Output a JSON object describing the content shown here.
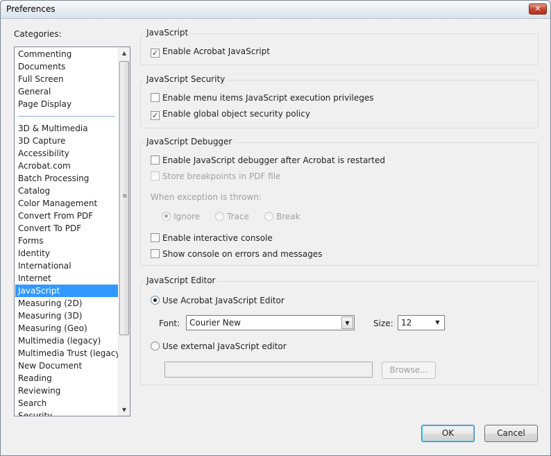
{
  "window": {
    "title": "Preferences",
    "close_glyph": "✕"
  },
  "categories": {
    "label": "Categories:",
    "top_items": [
      "Commenting",
      "Documents",
      "Full Screen",
      "General",
      "Page Display"
    ],
    "items": [
      "3D & Multimedia",
      "3D Capture",
      "Accessibility",
      "Acrobat.com",
      "Batch Processing",
      "Catalog",
      "Color Management",
      "Convert From PDF",
      "Convert To PDF",
      "Forms",
      "Identity",
      "International",
      "Internet",
      "JavaScript",
      "Measuring (2D)",
      "Measuring (3D)",
      "Measuring (Geo)",
      "Multimedia (legacy)",
      "Multimedia Trust (legacy)",
      "New Document",
      "Reading",
      "Reviewing",
      "Search",
      "Security"
    ],
    "selected": "JavaScript"
  },
  "javascript": {
    "title": "JavaScript",
    "enable_label": "Enable Acrobat JavaScript",
    "enable_checked": true
  },
  "security": {
    "title": "JavaScript Security",
    "menu_priv_label": "Enable menu items JavaScript execution privileges",
    "menu_priv_checked": false,
    "global_policy_label": "Enable global object security policy",
    "global_policy_checked": true
  },
  "debugger": {
    "title": "JavaScript Debugger",
    "enable_debugger_label": "Enable JavaScript debugger after Acrobat is restarted",
    "store_breakpoints_label": "Store breakpoints in PDF file",
    "exception_label": "When exception is thrown:",
    "options": [
      "Ignore",
      "Trace",
      "Break"
    ],
    "selected_option": "Ignore",
    "interactive_console_label": "Enable interactive console",
    "console_on_errors_label": "Show console on errors and messages"
  },
  "editor": {
    "title": "JavaScript Editor",
    "use_acrobat_label": "Use Acrobat JavaScript Editor",
    "font_label": "Font:",
    "font_value": "Courier New",
    "size_label": "Size:",
    "size_value": "12",
    "use_external_label": "Use external JavaScript editor",
    "external_path": "",
    "browse_label": "Browse..."
  },
  "buttons": {
    "ok": "OK",
    "cancel": "Cancel"
  },
  "glyphs": {
    "check": "✓",
    "up": "▲",
    "down": "▼",
    "grip": "≡"
  }
}
